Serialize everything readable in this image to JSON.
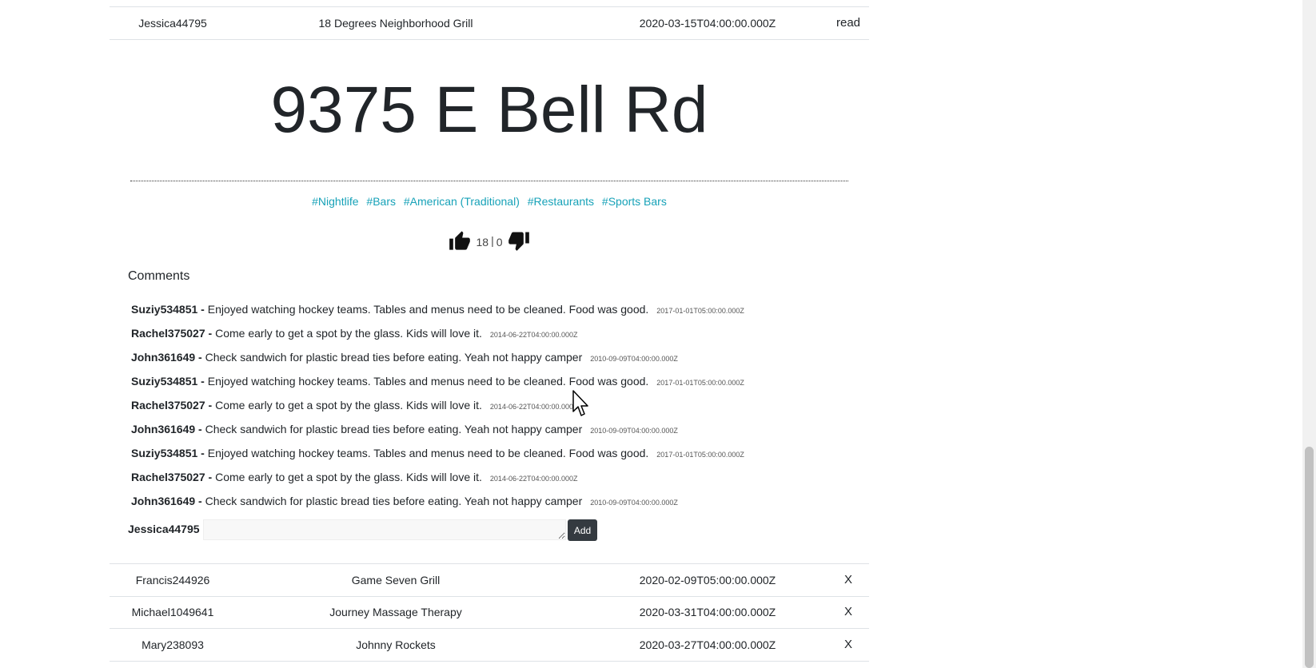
{
  "rows_above": [
    {
      "user": "Jessica44795",
      "business": "18 Degrees Neighborhood Grill",
      "date": "2020-03-15T04:00:00.000Z",
      "action": "read"
    }
  ],
  "detail": {
    "address": "9375 E Bell Rd",
    "tags": [
      "#Nightlife",
      "#Bars",
      "#American (Traditional)",
      "#Restaurants",
      "#Sports Bars"
    ],
    "likes": "18",
    "separator": "|",
    "dislikes": "0",
    "comments_title": "Comments",
    "comments": [
      {
        "user": "Suziy534851",
        "text": "Enjoyed watching hockey teams. Tables and menus need to be cleaned. Food was good.",
        "date": "2017-01-01T05:00:00.000Z"
      },
      {
        "user": "Rachel375027",
        "text": "Come early to get a spot by the glass. Kids will love it.",
        "date": "2014-06-22T04:00:00.000Z"
      },
      {
        "user": "John361649",
        "text": "Check sandwich for plastic bread ties before eating. Yeah not happy camper",
        "date": "2010-09-09T04:00:00.000Z"
      },
      {
        "user": "Suziy534851",
        "text": "Enjoyed watching hockey teams. Tables and menus need to be cleaned. Food was good.",
        "date": "2017-01-01T05:00:00.000Z"
      },
      {
        "user": "Rachel375027",
        "text": "Come early to get a spot by the glass. Kids will love it.",
        "date": "2014-06-22T04:00:00.000Z"
      },
      {
        "user": "John361649",
        "text": "Check sandwich for plastic bread ties before eating. Yeah not happy camper",
        "date": "2010-09-09T04:00:00.000Z"
      },
      {
        "user": "Suziy534851",
        "text": "Enjoyed watching hockey teams. Tables and menus need to be cleaned. Food was good.",
        "date": "2017-01-01T05:00:00.000Z"
      },
      {
        "user": "Rachel375027",
        "text": "Come early to get a spot by the glass. Kids will love it.",
        "date": "2014-06-22T04:00:00.000Z"
      },
      {
        "user": "John361649",
        "text": "Check sandwich for plastic bread ties before eating. Yeah not happy camper",
        "date": "2010-09-09T04:00:00.000Z"
      }
    ],
    "current_user": "Jessica44795",
    "comment_input_value": "",
    "add_label": "Add"
  },
  "rows_below": [
    {
      "user": "Francis244926",
      "business": "Game Seven Grill",
      "date": "2020-02-09T05:00:00.000Z",
      "action": "X"
    },
    {
      "user": "Michael1049641",
      "business": "Journey Massage Therapy",
      "date": "2020-03-31T04:00:00.000Z",
      "action": "X"
    },
    {
      "user": "Mary238093",
      "business": "Johnny Rockets",
      "date": "2020-03-27T04:00:00.000Z",
      "action": "X"
    }
  ],
  "colors": {
    "tag": "#17a2b8",
    "button": "#343a40"
  },
  "icons": {
    "like": "thumbs-up-icon",
    "dislike": "thumbs-down-icon"
  }
}
